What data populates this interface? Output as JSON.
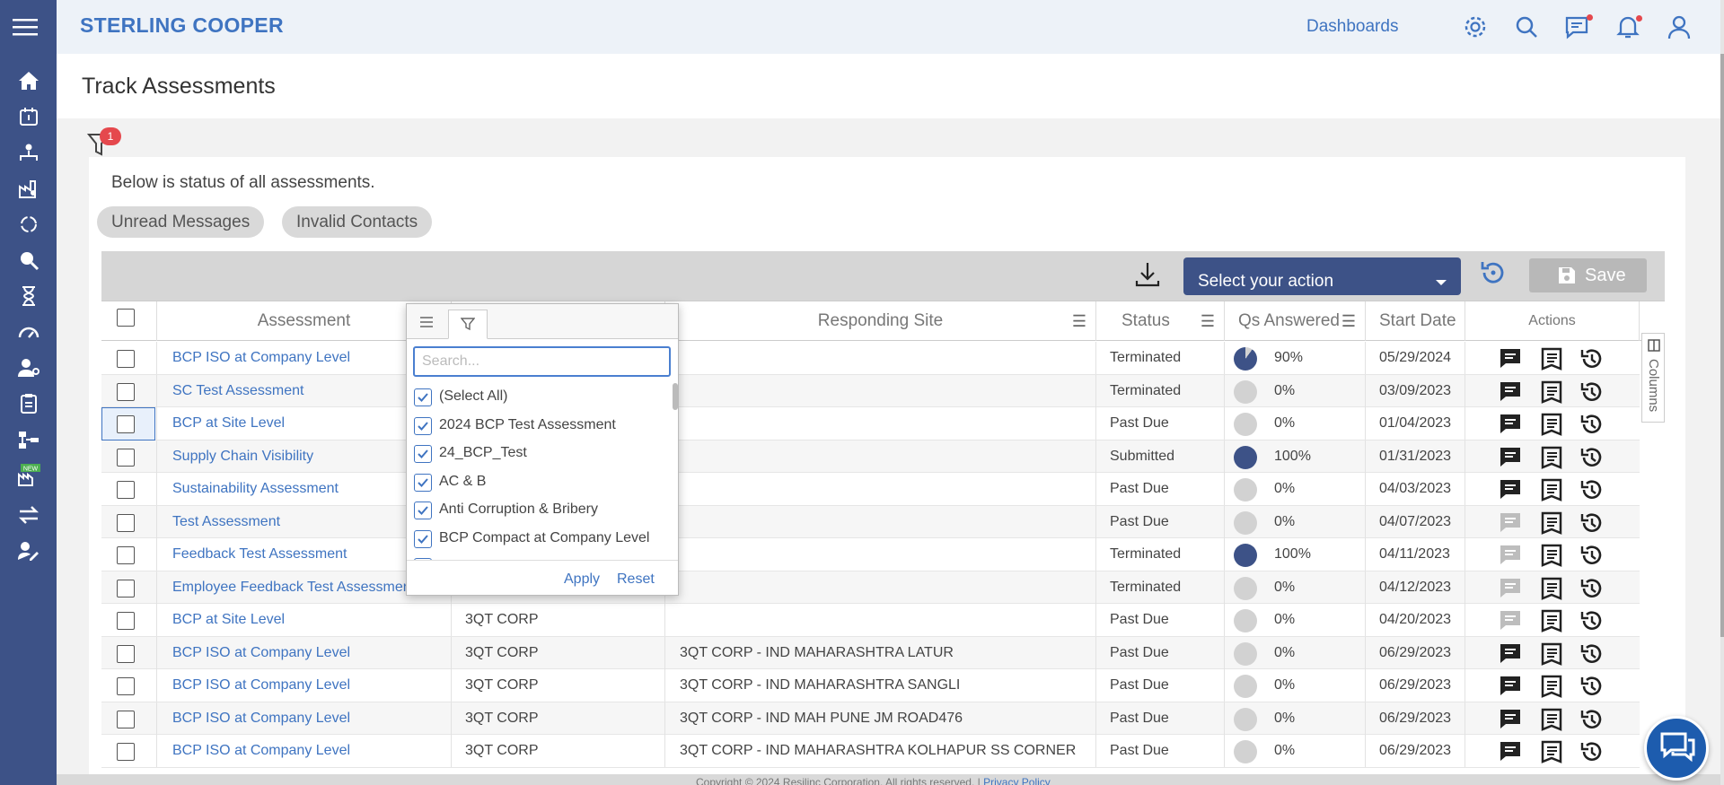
{
  "app": {
    "brand": "STERLING COOPER",
    "nav_dashboards": "Dashboards"
  },
  "header_icons": [
    "settings-icon",
    "search-icon",
    "messages-icon",
    "notifications-icon",
    "user-icon"
  ],
  "sidebar": {
    "items": [
      "home-icon",
      "calendar-alert-icon",
      "org-chart-icon",
      "factory-icon",
      "cycle-icon",
      "search-person-icon",
      "hourglass-icon",
      "gauge-icon",
      "user-settings-icon",
      "clipboard-icon",
      "hierarchy-icon",
      "new-feature-icon",
      "transfer-icon",
      "user-edit-icon"
    ]
  },
  "page": {
    "title": "Track Assessments",
    "filter_count": "1",
    "description": "Below is status of all assessments."
  },
  "chips": [
    "Unread Messages",
    "Invalid Contacts"
  ],
  "toolbar": {
    "action_placeholder": "Select your action",
    "save_label": "Save"
  },
  "columns": {
    "assessment": "Assessment",
    "responding_site": "Responding Site",
    "status": "Status",
    "qs_answered": "Qs Answered",
    "start_date": "Start Date",
    "actions": "Actions",
    "side_tab": "Columns"
  },
  "rows": [
    {
      "assessment": "BCP ISO at Company Level",
      "company": "",
      "site": "",
      "status": "Terminated",
      "qs": "90%",
      "pct": 90,
      "date": "05/29/2024",
      "msg_active": true
    },
    {
      "assessment": "SC Test Assessment",
      "company": "",
      "site": "",
      "status": "Terminated",
      "qs": "0%",
      "pct": 0,
      "date": "03/09/2023",
      "msg_active": true
    },
    {
      "assessment": "BCP at Site Level",
      "company": "",
      "site": "",
      "status": "Past Due",
      "qs": "0%",
      "pct": 0,
      "date": "01/04/2023",
      "msg_active": true
    },
    {
      "assessment": "Supply Chain Visibility",
      "company": "",
      "site": "",
      "status": "Submitted",
      "qs": "100%",
      "pct": 100,
      "date": "01/31/2023",
      "msg_active": true
    },
    {
      "assessment": "Sustainability Assessment",
      "company": "",
      "site": "",
      "status": "Past Due",
      "qs": "0%",
      "pct": 0,
      "date": "04/03/2023",
      "msg_active": true
    },
    {
      "assessment": "Test Assessment",
      "company": "",
      "site": "",
      "status": "Past Due",
      "qs": "0%",
      "pct": 0,
      "date": "04/07/2023",
      "msg_active": false
    },
    {
      "assessment": "Feedback Test Assessment",
      "company": "",
      "site": "",
      "status": "Terminated",
      "qs": "100%",
      "pct": 100,
      "date": "04/11/2023",
      "msg_active": false
    },
    {
      "assessment": "Employee Feedback Test Assessment",
      "company": "",
      "site": "",
      "status": "Terminated",
      "qs": "0%",
      "pct": 0,
      "date": "04/12/2023",
      "msg_active": false
    },
    {
      "assessment": "BCP at Site Level",
      "company": "3QT CORP",
      "site": "",
      "status": "Past Due",
      "qs": "0%",
      "pct": 0,
      "date": "04/20/2023",
      "msg_active": false
    },
    {
      "assessment": "BCP ISO at Company Level",
      "company": "3QT CORP",
      "site": "3QT CORP - IND MAHARASHTRA LATUR",
      "status": "Past Due",
      "qs": "0%",
      "pct": 0,
      "date": "06/29/2023",
      "msg_active": true
    },
    {
      "assessment": "BCP ISO at Company Level",
      "company": "3QT CORP",
      "site": "3QT CORP - IND MAHARASHTRA SANGLI",
      "status": "Past Due",
      "qs": "0%",
      "pct": 0,
      "date": "06/29/2023",
      "msg_active": true
    },
    {
      "assessment": "BCP ISO at Company Level",
      "company": "3QT CORP",
      "site": "3QT CORP - IND MAH PUNE JM ROAD476",
      "status": "Past Due",
      "qs": "0%",
      "pct": 0,
      "date": "06/29/2023",
      "msg_active": true
    },
    {
      "assessment": "BCP ISO at Company Level",
      "company": "3QT CORP",
      "site": "3QT CORP - IND MAHARASHTRA KOLHAPUR SS CORNER",
      "status": "Past Due",
      "qs": "0%",
      "pct": 0,
      "date": "06/29/2023",
      "msg_active": true
    }
  ],
  "filter_popup": {
    "search_placeholder": "Search...",
    "options": [
      "(Select All)",
      "2024 BCP Test Assessment",
      "24_BCP_Test",
      "AC & B",
      "Anti Corruption & Bribery",
      "BCP Compact at Company Level"
    ],
    "apply": "Apply",
    "reset": "Reset"
  },
  "footer": {
    "copyright": "Copyright © 2024 Resilinc Corporation. All rights reserved. | ",
    "privacy": "Privacy Policy"
  },
  "colors": {
    "sidebar": "#3d5287",
    "accent": "#3f74c1",
    "badge": "#e5484d",
    "chat": "#1d5cae"
  }
}
